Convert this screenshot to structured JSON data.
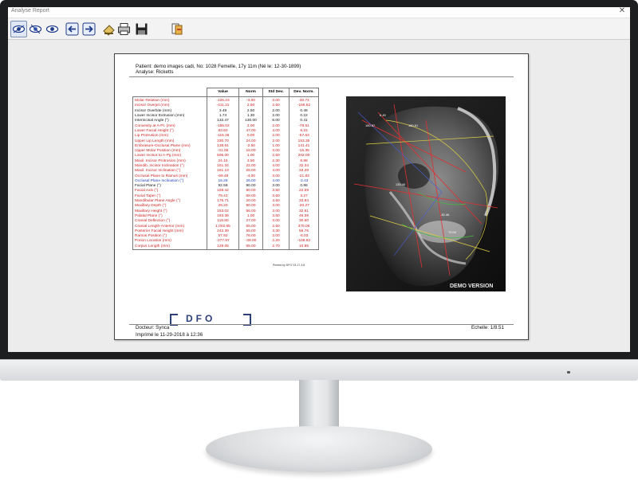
{
  "window": {
    "title": "Analyse Report",
    "close_glyph": "✕"
  },
  "toolbar": {
    "buttons": [
      {
        "icon": "eye-icon-1"
      },
      {
        "icon": "eye-icon-2"
      },
      {
        "icon": "eye-icon-3"
      },
      {
        "icon": "arrow-left-icon"
      },
      {
        "icon": "arrow-right-icon"
      },
      {
        "icon": "stamp-icon"
      },
      {
        "icon": "print-icon"
      },
      {
        "icon": "save-icon"
      },
      {
        "icon": "export-icon"
      }
    ]
  },
  "report": {
    "patient_line": "Patient: demo images cadi, No: 1028 Femelle, 17y 11m (Né le: 12-30-1899)",
    "analyse_line": "Analyse: Ricketts",
    "columns": [
      "Value",
      "Norm",
      "Std Dev.",
      "Dev. Norm."
    ],
    "rows": [
      {
        "name": "Molar Relation (mm)",
        "value": "-125.23",
        "norm": "-3.00",
        "std": "3.00",
        "dev": "-40.74",
        "color": "#cc1f1f"
      },
      {
        "name": "Incisor Overjet (mm)",
        "value": "-411.31",
        "norm": "2.50",
        "std": "2.50",
        "dev": "-165.52",
        "color": "#cc1f1f"
      },
      {
        "name": "Incisor Overbite (mm)",
        "value": "3.49",
        "norm": "2.50",
        "std": "2.00",
        "dev": "0.49",
        "color": "#111111"
      },
      {
        "name": "Lower Incisor Extrusion (mm)",
        "value": "1.74",
        "norm": "1.30",
        "std": "2.00",
        "dev": "0.22",
        "color": "#111111"
      },
      {
        "name": "Interincisal Angle (°)",
        "value": "132.47",
        "norm": "130.00",
        "std": "6.00",
        "dev": "0.41",
        "color": "#111111"
      },
      {
        "name": "Convexity at A-Pt. (mm)",
        "value": "-155.02",
        "norm": "2.00",
        "std": "2.00",
        "dev": "-78.51",
        "color": "#cc1f1f"
      },
      {
        "name": "Lower Facial Height (°)",
        "value": "83.60",
        "norm": "47.00",
        "std": "4.00",
        "dev": "9.15",
        "color": "#cc1f1f"
      },
      {
        "name": "Lip Protrusion (mm)",
        "value": "-115.26",
        "norm": "0.00",
        "std": "2.00",
        "dev": "-57.63",
        "color": "#cc1f1f"
      },
      {
        "name": "Upper Lip Length (mm)",
        "value": "330.70",
        "norm": "24.00",
        "std": "2.00",
        "dev": "153.35",
        "color": "#cc1f1f"
      },
      {
        "name": "Embrasure-Occlusal Plane (mm)",
        "value": "138.91",
        "norm": "-2.50",
        "std": "1.00",
        "dev": "141.41",
        "color": "#cc1f1f"
      },
      {
        "name": "Upper Molar Position (mm)",
        "value": "-31.06",
        "norm": "18.00",
        "std": "3.00",
        "dev": "-16.35",
        "color": "#cc1f1f"
      },
      {
        "name": "Lower Incisor to A-Pg (mm)",
        "value": "506.00",
        "norm": "1.00",
        "std": "2.50",
        "dev": "202.00",
        "color": "#cc1f1f"
      },
      {
        "name": "Maxil. Incisor Protrusion (mm)",
        "value": "24.15",
        "norm": "3.50",
        "std": "2.30",
        "dev": "8.98",
        "color": "#cc1f1f"
      },
      {
        "name": "Mandib. Incisor Inclination (°)",
        "value": "151.34",
        "norm": "22.00",
        "std": "4.00",
        "dev": "32.34",
        "color": "#cc1f1f"
      },
      {
        "name": "Maxil. Incisor Inclination (°)",
        "value": "161.13",
        "norm": "28.00",
        "std": "4.00",
        "dev": "33.28",
        "color": "#cc1f1f"
      },
      {
        "name": "Occlusal Plane to Ramus (mm)",
        "value": "-69.49",
        "norm": "-4.00",
        "std": "3.00",
        "dev": "-21.83",
        "color": "#cc1f1f"
      },
      {
        "name": "Occlusal Plane Inclination (°)",
        "value": "16.28",
        "norm": "26.00",
        "std": "4.00",
        "dev": "-2.43",
        "color": "#1f3fbf"
      },
      {
        "name": "Facial Plane (°)",
        "value": "92.58",
        "norm": "90.00",
        "std": "3.00",
        "dev": "0.86",
        "color": "#111111"
      },
      {
        "name": "Facial Axis (°)",
        "value": "169.42",
        "norm": "90.00",
        "std": "3.50",
        "dev": "22.69",
        "color": "#cc1f1f"
      },
      {
        "name": "Facial Taper (°)",
        "value": "79.43",
        "norm": "68.00",
        "std": "3.50",
        "dev": "3.27",
        "color": "#cc1f1f"
      },
      {
        "name": "Mandibular Plane Angle (°)",
        "value": "176.71",
        "norm": "20.00",
        "std": "4.50",
        "dev": "33.84",
        "color": "#cc1f1f"
      },
      {
        "name": "Maxillary Depth (°)",
        "value": "29.20",
        "norm": "90.00",
        "std": "3.00",
        "dev": "-20.27",
        "color": "#cc1f1f"
      },
      {
        "name": "Maxillary Height (°)",
        "value": "153.02",
        "norm": "56.00",
        "std": "3.00",
        "dev": "32.61",
        "color": "#cc1f1f"
      },
      {
        "name": "Palatal Plane (°)",
        "value": "163.36",
        "norm": "1.00",
        "std": "3.50",
        "dev": "46.39",
        "color": "#cc1f1f"
      },
      {
        "name": "Cranial Deflection (°)",
        "value": "118.80",
        "norm": "27.00",
        "std": "3.00",
        "dev": "30.60",
        "color": "#cc1f1f"
      },
      {
        "name": "Cranial Length-Anterior (mm)",
        "value": "1,002.65",
        "norm": "55.00",
        "std": "2.50",
        "dev": "379.06",
        "color": "#cc1f1f"
      },
      {
        "name": "Posterior Facial Height (mm)",
        "value": "242.39",
        "norm": "55.00",
        "std": "3.30",
        "dev": "56.76",
        "color": "#cc1f1f"
      },
      {
        "name": "Ramus Position (°)",
        "value": "57.92",
        "norm": "76.00",
        "std": "3.00",
        "dev": "-6.03",
        "color": "#cc1f1f"
      },
      {
        "name": "Porion Location (mm)",
        "value": "-277.97",
        "norm": "-39.00",
        "std": "2.20",
        "dev": "-108.62",
        "color": "#cc1f1f"
      },
      {
        "name": "Corpus Length (mm)",
        "value": "129.05",
        "norm": "65.00",
        "std": "2.70",
        "dev": "10.95",
        "color": "#cc1f1f"
      }
    ],
    "printed_by": "Printed by DFO V3.17.3.8",
    "xray_watermark": "DEMO VERSION",
    "xray_labels": [
      "6.45",
      "180.61",
      "180.87",
      "130.40",
      "-30.46",
      "70.00"
    ],
    "logo_text": "DFO",
    "doctor_line": "Docteur: Synca",
    "printed_line": "Imprimé le 11-29-2018 à 12:36",
    "scale_line": "Echelle: 1/8.51"
  }
}
